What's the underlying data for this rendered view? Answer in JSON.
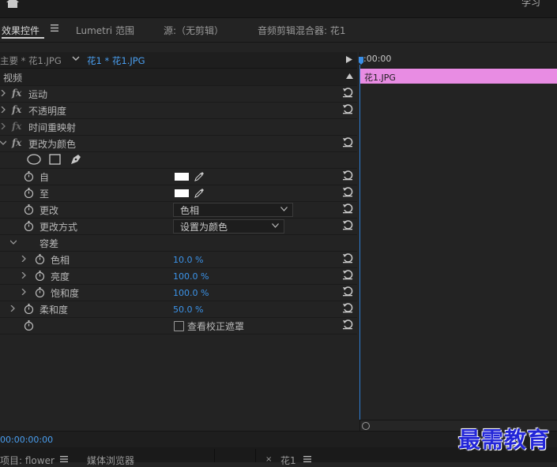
{
  "topbar": {
    "learn_label": "学习"
  },
  "tabs": [
    {
      "label": "效果控件"
    },
    {
      "label": "Lumetri 范围"
    },
    {
      "label": "源:（无剪辑）"
    },
    {
      "label": "音频剪辑混合器: 花1"
    }
  ],
  "sequence": {
    "master_label": "主要 * 花1.JPG",
    "clip_label": "花1 * 花1.JPG"
  },
  "effects": {
    "section_video": "视频",
    "motion": "运动",
    "opacity": "不透明度",
    "time_remap": "时间重映射",
    "change_to_color": "更改为颜色",
    "from_label": "自",
    "to_label": "至",
    "change_label": "更改",
    "change_value": "色相",
    "change_by_label": "更改方式",
    "change_by_value": "设置为颜色",
    "tolerance_label": "容差",
    "hue_label": "色相",
    "hue_value": "10.0 %",
    "lightness_label": "亮度",
    "lightness_value": "100.0 %",
    "saturation_label": "饱和度",
    "saturation_value": "100.0 %",
    "softness_label": "柔和度",
    "softness_value": "50.0 %",
    "view_mask_label": "查看校正遮罩",
    "view_mask_checked": false
  },
  "timeline": {
    "ruler_time": ":00:00",
    "clip_name": "花1.JPG"
  },
  "status": {
    "timecode": "00:00:00:00"
  },
  "bottom_tabs": [
    {
      "label": "项目: flower"
    },
    {
      "label": "媒体浏览器"
    },
    {
      "label": "花1"
    }
  ],
  "watermark": "最需教育",
  "colors": {
    "accent_blue": "#3c94ea",
    "clip_pink": "#e88ce3",
    "swatch_white": "#ffffff"
  }
}
